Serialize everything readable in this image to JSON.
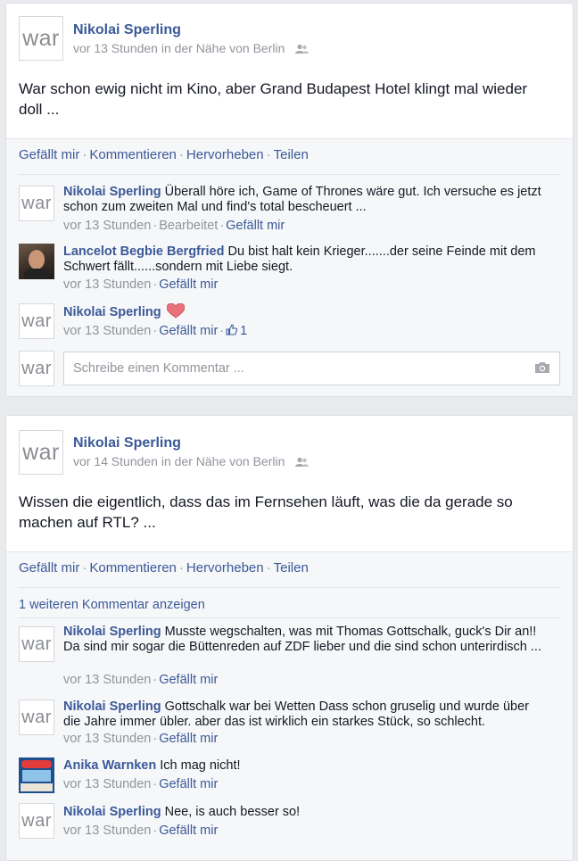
{
  "posts": [
    {
      "avatar_text": "war",
      "author": "Nikolai Sperling",
      "meta": "vor 13 Stunden in der Nähe von Berlin",
      "message": "War schon ewig nicht im Kino, aber Grand Budapest Hotel klingt mal wieder doll ...",
      "actions": [
        "Gefällt mir",
        "Kommentieren",
        "Hervorheben",
        "Teilen"
      ],
      "comments": [
        {
          "avatar_text": "war",
          "author": "Nikolai Sperling",
          "text": "Überall höre ich, Game of Thrones wäre gut. Ich versuche es jetzt schon zum zweiten Mal und find's total bescheuert ...",
          "time": "vor 13 Stunden",
          "edited": "Bearbeitet",
          "like": "Gefällt mir"
        },
        {
          "avatar_text": "",
          "author": "Lancelot Begbie Bergfried",
          "text": "Du bist halt kein Krieger.......der seine Feinde mit dem Schwert fällt......sondern mit Liebe siegt.",
          "time": "vor 13 Stunden",
          "like": "Gefällt mir"
        },
        {
          "avatar_text": "war",
          "author": "Nikolai Sperling",
          "text": "",
          "time": "vor 13 Stunden",
          "like": "Gefällt mir",
          "like_count": "1"
        }
      ],
      "composer": {
        "avatar_text": "war",
        "placeholder": "Schreibe einen Kommentar ..."
      }
    },
    {
      "avatar_text": "war",
      "author": "Nikolai Sperling",
      "meta": "vor 14 Stunden in der Nähe von Berlin",
      "message": "Wissen die eigentlich, dass das im Fernsehen läuft, was die da gerade so machen auf RTL? ...",
      "actions": [
        "Gefällt mir",
        "Kommentieren",
        "Hervorheben",
        "Teilen"
      ],
      "more_comments": "1 weiteren Kommentar anzeigen",
      "comments": [
        {
          "avatar_text": "war",
          "author": "Nikolai Sperling",
          "text": "Musste wegschalten, was mit Thomas Gottschalk, guck's Dir an!! Da sind mir sogar die Büttenreden auf ZDF lieber und die sind schon unterirdisch ...",
          "time": "vor 13 Stunden",
          "like": "Gefällt mir"
        },
        {
          "avatar_text": "war",
          "author": "Nikolai Sperling",
          "text": "Gottschalk war bei Wetten Dass schon gruselig und wurde über die Jahre immer übler. aber das ist wirklich ein starkes Stück, so schlecht.",
          "time": "vor 13 Stunden",
          "like": "Gefällt mir"
        },
        {
          "avatar_text": "",
          "author": "Anika Warnken",
          "text": "Ich mag nicht!",
          "time": "vor 13 Stunden",
          "like": "Gefällt mir"
        },
        {
          "avatar_text": "war",
          "author": "Nikolai Sperling",
          "text": "Nee, is auch besser so!",
          "time": "vor 13 Stunden",
          "like": "Gefällt mir"
        }
      ]
    }
  ],
  "icons": {
    "audience": "friends-icon",
    "heart": "heart-icon",
    "thumb": "thumbs-up-icon",
    "camera": "camera-icon"
  },
  "colors": {
    "link": "#3b5998",
    "meta": "#90949c",
    "heart": "#e9717a"
  }
}
